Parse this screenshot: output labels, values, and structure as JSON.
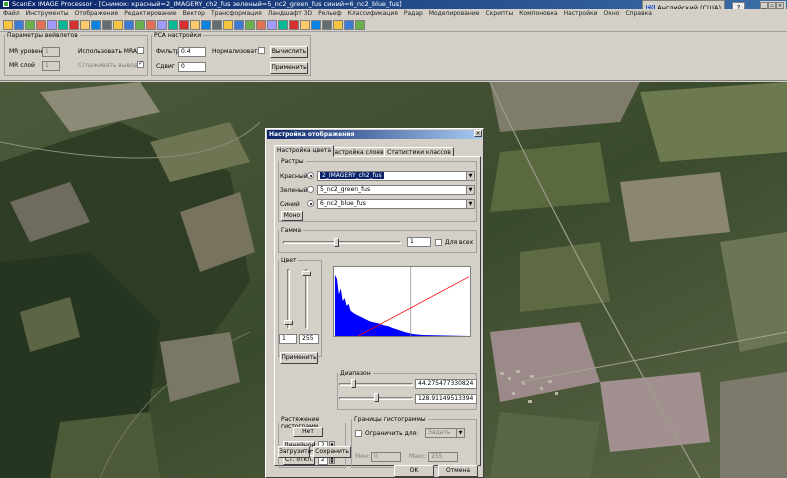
{
  "app": {
    "title": "ScanEx IMAGE Processor - [Снимок: красный=2_IMAGERY_ch2_fus зеленый=5_nc2_green_fus синий=6_nc2_blue_fus]",
    "language_label": "Английский (США)",
    "language_badge": "EN",
    "help_label": "?"
  },
  "menu": [
    "Файл",
    "Инструменты",
    "Отображение",
    "Редактирование",
    "Вектор",
    "Трансформация",
    "Ландшафт 3D",
    "Рельеф",
    "Классификация",
    "Радар",
    "Моделирование",
    "Скрипты",
    "Компоновка",
    "Настройки",
    "Окно",
    "Справка"
  ],
  "toolbar_icons": [
    "open-icon",
    "save-icon",
    "folder-icon",
    "layers-icon",
    "hand-icon",
    "zoom-in-icon",
    "zoom-out-icon",
    "zoom-box-icon",
    "zoom-fit-icon",
    "zoom-layer-icon",
    "pencil-icon",
    "grid-icon",
    "monitor-icon",
    "stack-icon",
    "info-icon",
    "image-icon",
    "chart-icon",
    "rgb-icon",
    "bars-icon",
    "table-icon",
    "select-icon",
    "hsv-icon",
    "globe-icon",
    "curve-icon",
    "window-icon",
    "record-icon",
    "crosshair-icon",
    "stamp-icon",
    "compass-icon",
    "pan-icon",
    "zoom-icon",
    "settings-icon",
    "frame-icon"
  ],
  "wavelet": {
    "legend": "Параметры вейвлетов",
    "mr_level_label": "MR уровень",
    "mr_level_value": "1",
    "use_mra_label": "Использовать MRA",
    "mr_layer_label": "MR слой",
    "mr_layer_value": "1",
    "smooth_output_label": "Сглаживать вывод"
  },
  "pca": {
    "legend": "PCA настройки",
    "filter_label": "Фильтр",
    "filter_value": "0.4",
    "normalize_label": "Нормализовать",
    "shift_label": "Сдвиг",
    "shift_value": "0",
    "compute_button": "Вычислить",
    "apply_button": "Применить"
  },
  "dialog": {
    "title": "Настройка отображения",
    "close_label": "×",
    "tabs": [
      "Настройка цвета",
      "Настройка слоев",
      "Статистики классов"
    ],
    "rasters": {
      "legend": "Растры",
      "red_label": "Красный",
      "red_value": "2_IMAGERY_ch2_fus",
      "green_label": "Зеленый",
      "green_value": "5_nc2_green_fus",
      "blue_label": "Синий",
      "blue_value": "6_nc2_blue_fus",
      "mono_button": "Моно"
    },
    "gamma": {
      "legend": "Гамма",
      "value": "1",
      "for_all_label": "Для всех",
      "level": 0.45
    },
    "color": {
      "legend": "Цвет",
      "min_value": "1",
      "max_value": "255",
      "apply_button": "Применить"
    },
    "range": {
      "legend": "Диапазон",
      "low_value": "44.275477330824",
      "high_value": "128.91149513394",
      "low_level": 0.17,
      "high_level": 0.5
    },
    "stretch": {
      "legend": "Растяжение гистограмм",
      "none_button": "Нет",
      "linear_button": "Линейное",
      "linear_value": "2",
      "stddev_button": "Ст. откл.",
      "stddev_value": "2"
    },
    "bounds": {
      "legend": "Границы гистограммы",
      "limit_label": "Ограничить для:",
      "limit_select": "Задать",
      "min_label": "Мин:",
      "min_value": "0",
      "max_label": "Макс:",
      "max_value": "255"
    },
    "load_button": "Загрузить",
    "save_button": "Сохранить",
    "ok_button": "OK",
    "cancel_button": "Отмена"
  }
}
